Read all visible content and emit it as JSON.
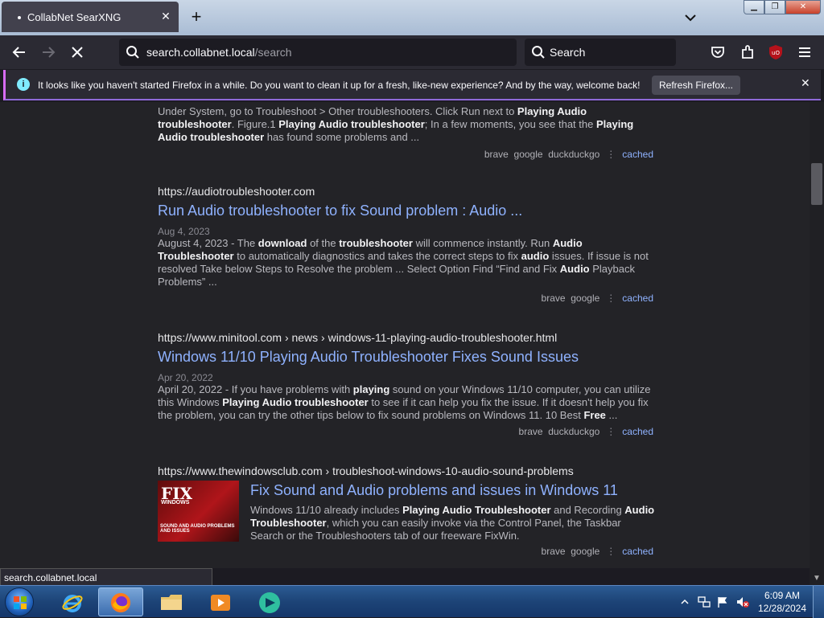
{
  "browser": {
    "tab_title": "CollabNet SearXNG",
    "url_domain": "search.collabnet.local",
    "url_path": "/search",
    "search_placeholder": "Search",
    "notification": "It looks like you haven't started Firefox in a while. Do you want to clean it up for a fresh, like-new experience? And by the way, welcome back!",
    "refresh_label": "Refresh Firefox...",
    "status_url": "search.collabnet.local"
  },
  "results": [
    {
      "snippet_html": "Under System, go to Troubleshoot &gt; Other troubleshooters. Click Run next to <b>Playing Audio troubleshooter</b>. Figure.1 <b>Playing Audio troubleshooter</b>; In a few moments, you see that the <b>Playing Audio troubleshooter</b> has found some problems and ...",
      "engines": [
        "brave",
        "google",
        "duckduckgo"
      ],
      "cached": "cached"
    },
    {
      "url": "https://audiotroubleshooter.com",
      "title": "Run Audio troubleshooter to fix Sound problem : Audio ...",
      "date": "Aug 4, 2023",
      "snippet_html": "August 4, 2023 - The <b>download</b> of the <b>troubleshooter</b> will commence instantly. Run <b>Audio Troubleshooter</b> to automatically diagnostics and takes the correct steps to fix <b>audio</b> issues. If issue is not resolved Take below Steps to Resolve the problem ... Select Option Find “Find and Fix <b>Audio</b> Playback Problems” ...",
      "engines": [
        "brave",
        "google"
      ],
      "cached": "cached"
    },
    {
      "url": "https://www.minitool.com  › news › windows-11-playing-audio-troubleshooter.html",
      "title": "Windows 11/10 Playing Audio Troubleshooter Fixes Sound Issues",
      "date": "Apr 20, 2022",
      "snippet_html": "April 20, 2022 - If you have problems with <b>playing</b> sound on your Windows 11/10 computer, you can utilize this Windows <b>Playing Audio troubleshooter</b> to see if it can help you fix the issue. If it doesn't help you fix the problem, you can try the other tips below to fix sound problems on Windows 11. 10 Best <b>Free</b> ...",
      "engines": [
        "brave",
        "duckduckgo"
      ],
      "cached": "cached"
    },
    {
      "url": "https://www.thewindowsclub.com › troubleshoot-windows-10-audio-sound-problems",
      "title": "Fix Sound and Audio problems and issues in Windows 11",
      "snippet_html": "Windows 11/10 already includes <b>Playing Audio Troubleshooter</b> and Recording <b>Audio Troubleshooter</b>, which you can easily invoke via the Control Panel, the Taskbar Search or the Troubleshooters tab of our freeware FixWin.",
      "engines": [
        "brave",
        "google"
      ],
      "cached": "cached",
      "thumb_text_big": "FIX",
      "thumb_text_small": "WINDOWS",
      "thumb_text_caption": "SOUND AND AUDIO PROBLEMS AND ISSUES"
    }
  ],
  "taskbar": {
    "time": "6:09 AM",
    "date": "12/28/2024"
  },
  "colors": {
    "accent": "#8fb2ff",
    "background": "#232327",
    "toolbar": "#2b2a33"
  }
}
